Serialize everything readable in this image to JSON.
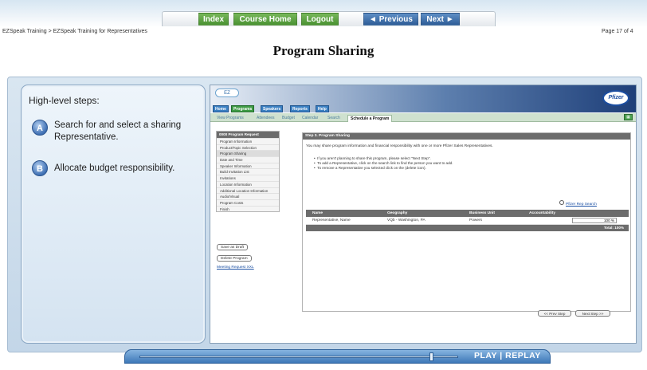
{
  "nav": {
    "index": "Index",
    "course_home": "Course Home",
    "logout": "Logout",
    "previous": "◄ Previous",
    "next": "Next ►"
  },
  "breadcrumb": "EZSpeak Training > EZSpeak Training for Representatives",
  "page_indicator": "Page 17 of 4",
  "page_title": "Program Sharing",
  "steps": {
    "heading": "High-level steps:",
    "items": [
      {
        "letter": "A",
        "text": "Search for and select a sharing Representative."
      },
      {
        "letter": "B",
        "text": "Allocate budget responsibility."
      }
    ]
  },
  "app": {
    "logo": "EZ",
    "brand": "Pfizer",
    "main_tabs": [
      "Home",
      "Programs",
      "Speakers",
      "Reports",
      "Help"
    ],
    "sub_tabs": [
      "View Programs",
      "Attendees",
      "Budget",
      "Calendar",
      "Search",
      "Schedule a Program"
    ],
    "left_nav_header": "0000 Program Request",
    "left_nav": [
      "Program Information",
      "Product/Topic Selection",
      "Program Sharing",
      "Date and Time",
      "Speaker Information",
      "Build Invitation List",
      "Invitations",
      "Location Information",
      "Additional Location Information",
      "Audio/Visual",
      "Program Costs",
      "Finish"
    ],
    "save_draft": "Save as Draft",
    "delete_program": "Delete Program",
    "meeting_request": "Meeting Request XXL",
    "content_header": "Step 3. Program Sharing",
    "intro": "You may share program information and financial responsibility with one or more Pfizer Sales Representatives.",
    "bullets": [
      "If you aren't planning to share this program, please select \"Next Step\".",
      "To add a Representative, click on the search link to find the person you want to add.",
      "To remove a Representative you selected click on the (delete icon)."
    ],
    "search_link": "Pfizer Rep Search",
    "table": {
      "headers": [
        "Name",
        "Geography",
        "Business Unit",
        "Accountability"
      ],
      "row": {
        "name": "Representative, Name",
        "geo": "VQb - Washington, PA",
        "bu": "Powers",
        "acc": "100 %"
      },
      "total": "Total: 100%"
    },
    "prev_step": "<< Prev Step",
    "next_step": "Next Step >>"
  },
  "player": {
    "label": "PLAY  |  REPLAY",
    "progress": 0.96
  }
}
